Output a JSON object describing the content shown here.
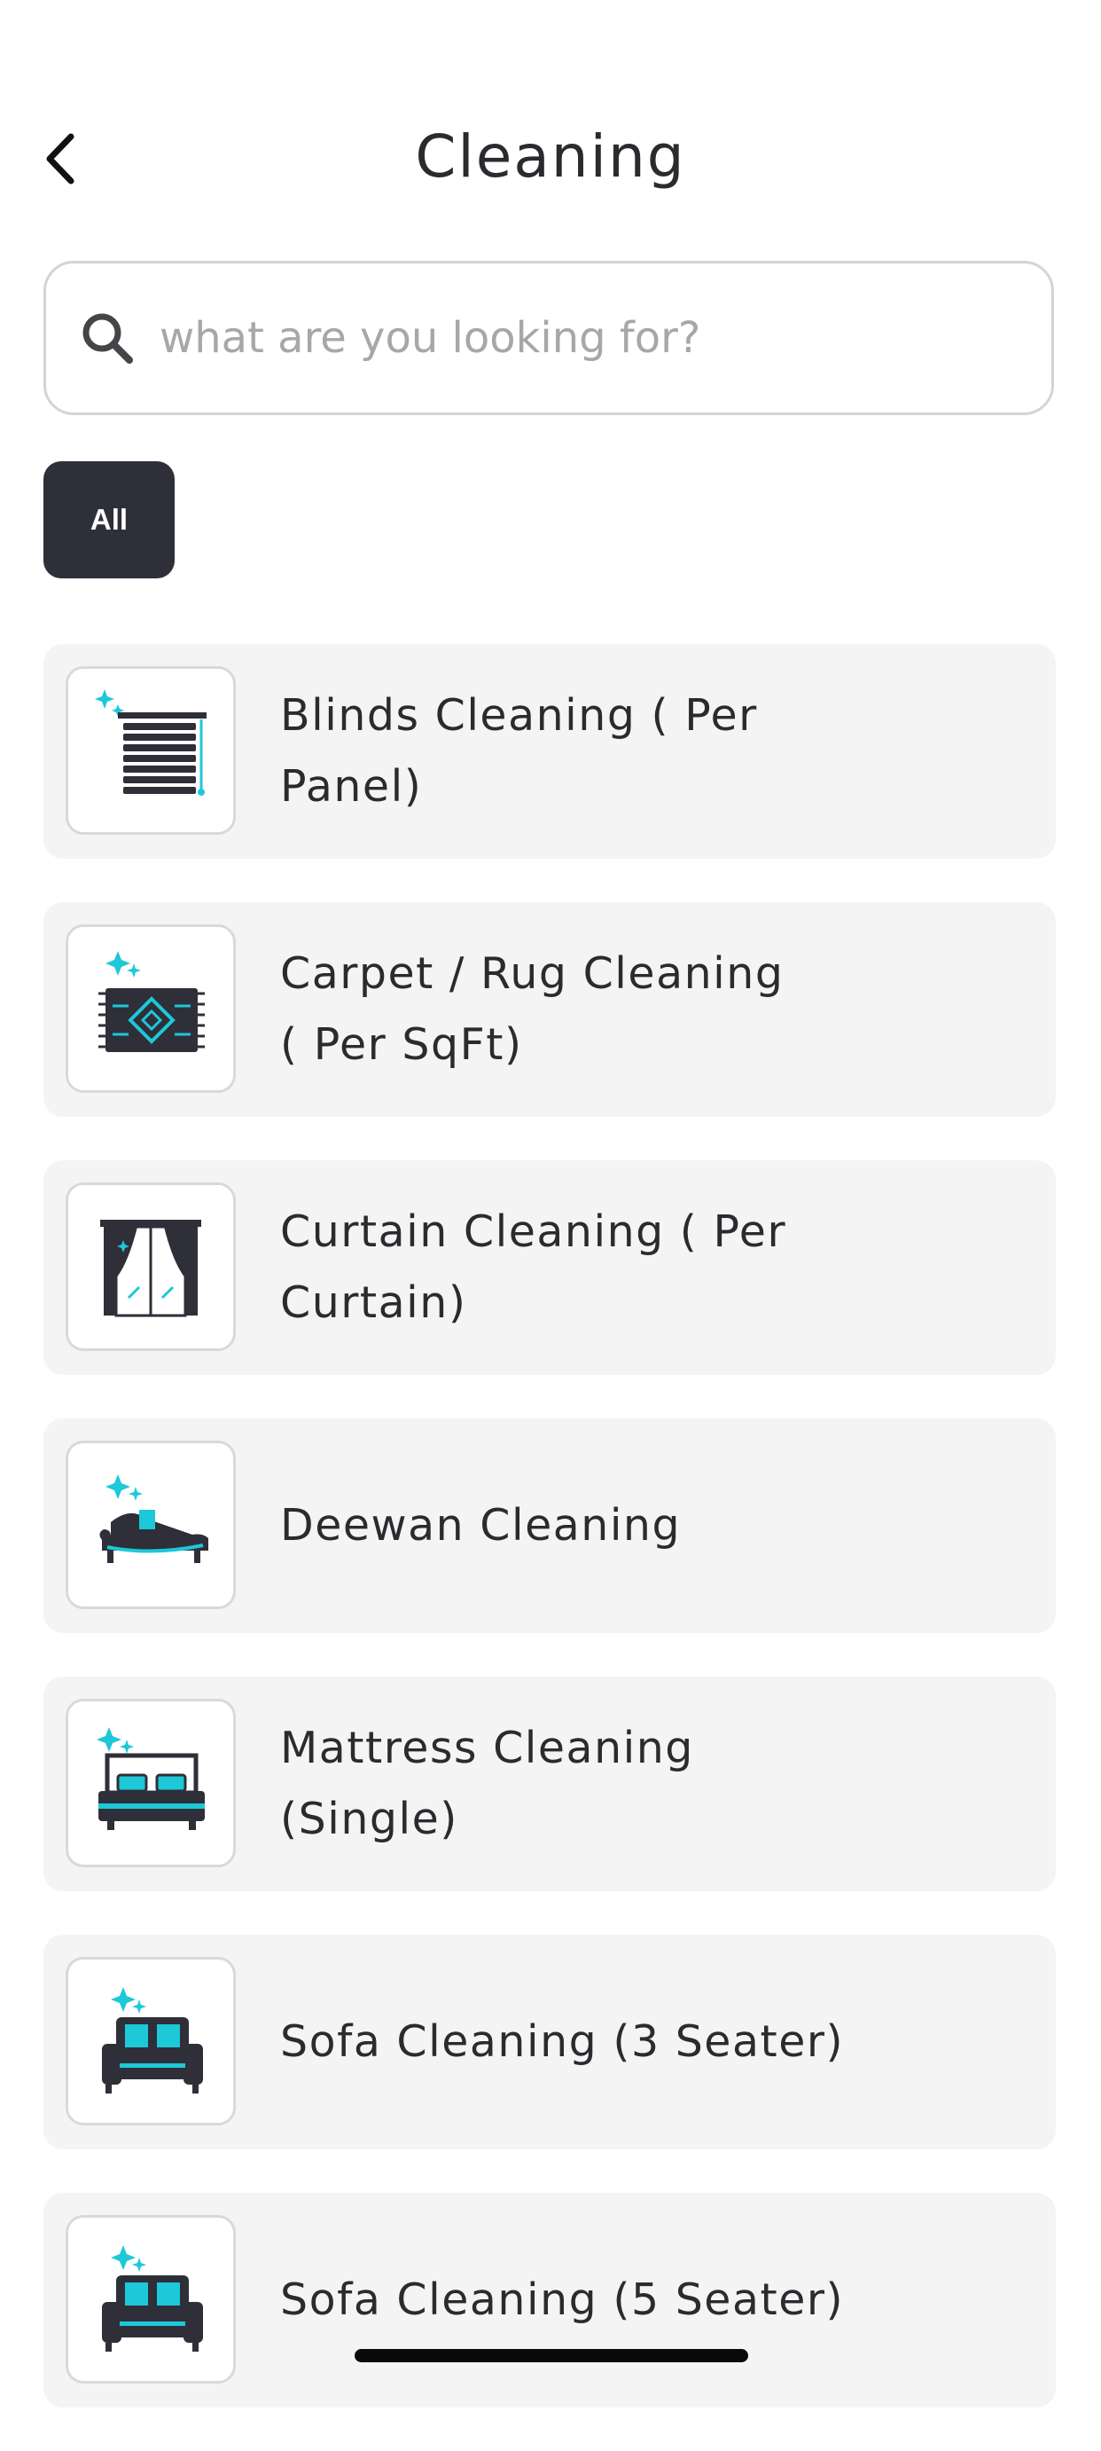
{
  "header": {
    "title": "Cleaning",
    "back_icon": "chevron-left-icon"
  },
  "search": {
    "placeholder": "what are you looking for?",
    "value": "",
    "icon": "search-icon"
  },
  "filters": [
    {
      "label": "All",
      "selected": true
    }
  ],
  "services": [
    {
      "label": "Blinds Cleaning ( Per Panel)",
      "icon": "blinds-icon"
    },
    {
      "label": "Carpet / Rug Cleaning ( Per SqFt)",
      "icon": "carpet-icon"
    },
    {
      "label": "Curtain Cleaning ( Per Curtain)",
      "icon": "curtain-icon"
    },
    {
      "label": "Deewan Cleaning",
      "icon": "deewan-icon"
    },
    {
      "label": "Mattress Cleaning (Single)",
      "icon": "mattress-icon"
    },
    {
      "label": "Sofa Cleaning (3 Seater)",
      "icon": "sofa-icon"
    },
    {
      "label": "Sofa Cleaning (5 Seater)",
      "icon": "sofa-icon"
    }
  ],
  "colors": {
    "accent": "#1dc8d8",
    "dark": "#2e2f38",
    "card_background": "#f4f4f4"
  }
}
